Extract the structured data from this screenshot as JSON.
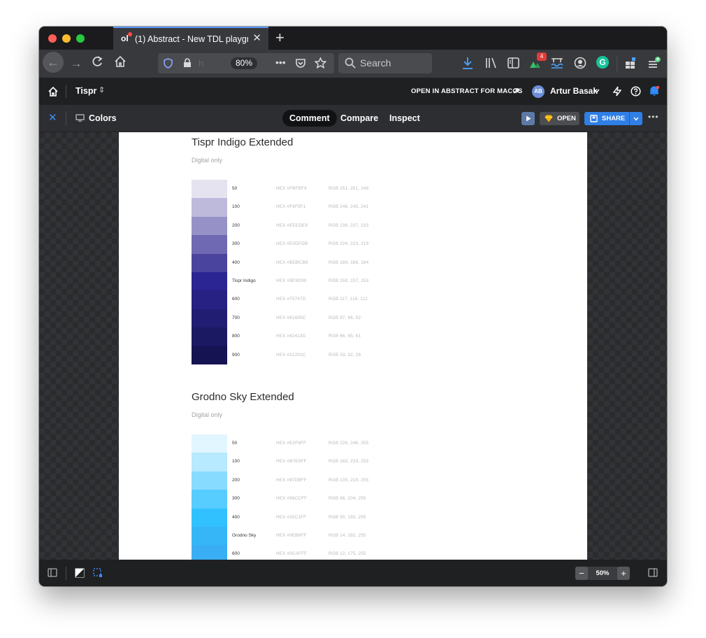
{
  "browser": {
    "tab_title": "(1) Abstract - New TDL playground",
    "tab_favicon": "ol",
    "zoom": "80%",
    "url_partial": "h",
    "search_placeholder": "Search",
    "addon_badge": "4"
  },
  "appbar": {
    "project": "Tispr",
    "open_in_app": "OPEN IN ABSTRACT FOR MACOS",
    "user_initials": "AB",
    "user_name": "Artur Basak"
  },
  "toolbar": {
    "page_title": "Colors",
    "modes": [
      "Comment",
      "Compare",
      "Inspect"
    ],
    "active_mode": "Comment",
    "open_label": "OPEN",
    "share_label": "SHARE"
  },
  "sections": [
    {
      "title": "Tispr Indigo Extended",
      "subtitle": "Digital only",
      "swatches": [
        {
          "name": "50",
          "hex": "HEX #FBFBF9",
          "rgb": "RGB 251, 251, 249",
          "color": "#e4e3ef"
        },
        {
          "name": "100",
          "hex": "HEX #F6F5F1",
          "rgb": "RGB 246, 245, 241",
          "color": "#bdbadc"
        },
        {
          "name": "200",
          "hex": "HEX #EEEDE9",
          "rgb": "RGB 238, 237, 233",
          "color": "#9692c7"
        },
        {
          "name": "300",
          "hex": "HEX #E0DFDB",
          "rgb": "RGB 224, 223, 219",
          "color": "#6f69b3"
        },
        {
          "name": "400",
          "hex": "HEX #BDBCB8",
          "rgb": "RGB 189, 188, 184",
          "color": "#4a449f"
        },
        {
          "name": "Tispr Indigo",
          "hex": "HEX #9E9D99",
          "rgb": "RGB 158, 157, 153",
          "color": "#2a2592"
        },
        {
          "name": "600",
          "hex": "HEX #75747D",
          "rgb": "RGB 117, 116, 112",
          "color": "#262182"
        },
        {
          "name": "700",
          "hex": "HEX #61605C",
          "rgb": "RGB 97, 96, 92",
          "color": "#211d72"
        },
        {
          "name": "800",
          "hex": "HEX #42413D",
          "rgb": "RGB 66, 65, 61",
          "color": "#1c1963"
        },
        {
          "name": "900",
          "hex": "HEX #21201C",
          "rgb": "RGB 33, 32, 28",
          "color": "#151352"
        }
      ]
    },
    {
      "title": "Grodno Sky Extended",
      "subtitle": "Digital only",
      "swatches": [
        {
          "name": "50",
          "hex": "HEX #E2F6FF",
          "rgb": "RGB 226, 246, 255",
          "color": "#e2f6ff"
        },
        {
          "name": "100",
          "hex": "HEX #B7E9FF",
          "rgb": "RGB 183, 233, 255",
          "color": "#b7e9ff"
        },
        {
          "name": "200",
          "hex": "HEX #87DBFF",
          "rgb": "RGB 135, 219, 255",
          "color": "#87dbff"
        },
        {
          "name": "300",
          "hex": "HEX #56CCFF",
          "rgb": "RGB 86, 204, 255",
          "color": "#56ccff"
        },
        {
          "name": "400",
          "hex": "HEX #32C1FF",
          "rgb": "RGB 50, 193, 255",
          "color": "#32c1ff"
        },
        {
          "name": "Grodno Sky",
          "hex": "HEX #0EB6FF",
          "rgb": "RGB 14, 182, 255",
          "color": "#36b6f6"
        },
        {
          "name": "600",
          "hex": "HEX #0CAFFF",
          "rgb": "RGB 12, 175, 255",
          "color": "#3aaef4"
        }
      ]
    }
  ],
  "bottombar": {
    "zoom": "50%"
  }
}
